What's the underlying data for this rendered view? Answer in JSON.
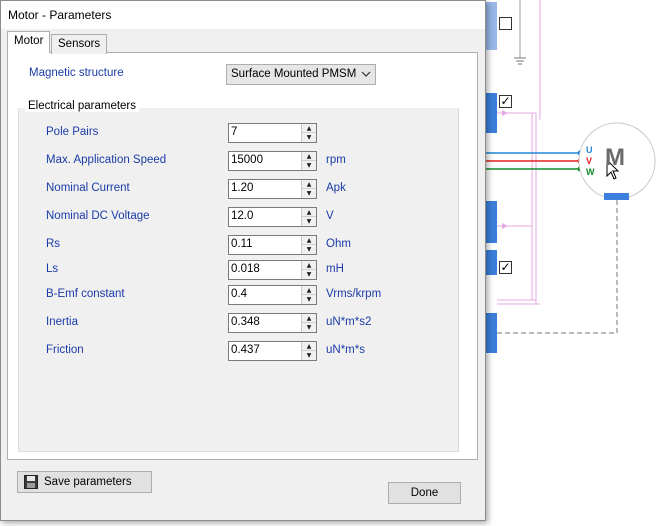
{
  "window": {
    "title": "Motor - Parameters"
  },
  "tabs": [
    {
      "label": "Motor"
    },
    {
      "label": "Sensors"
    }
  ],
  "magnetic": {
    "label": "Magnetic structure",
    "value": "Surface Mounted PMSM"
  },
  "group": {
    "title": "Electrical parameters"
  },
  "params": [
    {
      "label": "Pole Pairs",
      "value": "7",
      "unit": ""
    },
    {
      "label": "Max. Application Speed",
      "value": "15000",
      "unit": "rpm"
    },
    {
      "label": "Nominal Current",
      "value": "1.20",
      "unit": "Apk"
    },
    {
      "label": "Nominal DC Voltage",
      "value": "12.0",
      "unit": "V"
    },
    {
      "label": "Rs",
      "value": "0.11",
      "unit": "Ohm"
    },
    {
      "label": "Ls",
      "value": "0.018",
      "unit": "mH"
    },
    {
      "label": "B-Emf constant",
      "value": "0.4",
      "unit": "Vrms/krpm"
    },
    {
      "label": "Inertia",
      "value": "0.348",
      "unit": "uN*m*s2"
    },
    {
      "label": "Friction",
      "value": "0.437",
      "unit": "uN*m*s"
    }
  ],
  "buttons": {
    "save": "Save parameters",
    "done": "Done"
  },
  "motor": {
    "letter": "M",
    "phase_u": "U",
    "phase_v": "V",
    "phase_w": "W"
  },
  "colors": {
    "accent_blue": "#3c7fdc",
    "phase_u": "#1e88d6",
    "phase_v": "#e0201e",
    "phase_w": "#118a2a",
    "label_text": "#1b3ba8"
  }
}
